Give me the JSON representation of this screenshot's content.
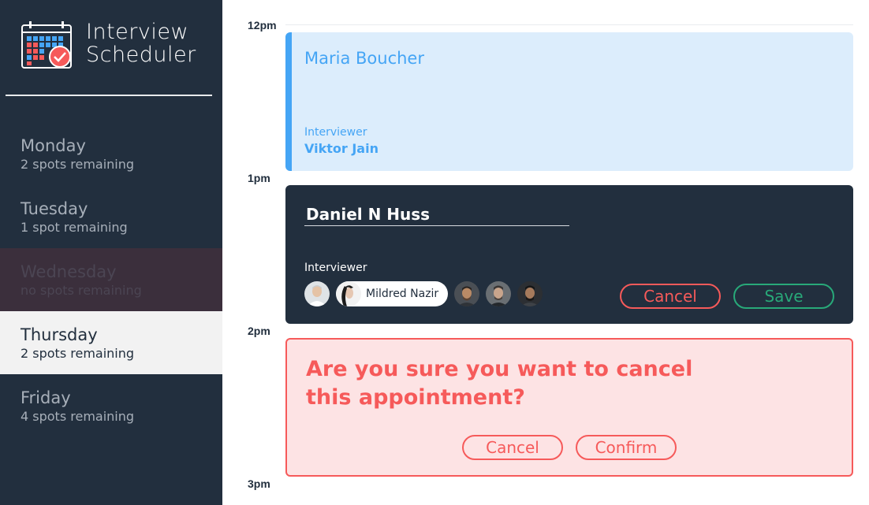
{
  "app": {
    "title_line1": "Interview",
    "title_line2": "Scheduler",
    "icon": "calendar-check-icon"
  },
  "days": [
    {
      "name": "Monday",
      "spots": "2 spots remaining",
      "state": "normal"
    },
    {
      "name": "Tuesday",
      "spots": "1 spot remaining",
      "state": "normal"
    },
    {
      "name": "Wednesday",
      "spots": "no spots remaining",
      "state": "full"
    },
    {
      "name": "Thursday",
      "spots": "2 spots remaining",
      "state": "selected"
    },
    {
      "name": "Friday",
      "spots": "4 spots remaining",
      "state": "normal"
    }
  ],
  "hours": [
    "12pm",
    "1pm",
    "2pm",
    "3pm"
  ],
  "booked": {
    "student": "Maria Boucher",
    "interviewer_label": "Interviewer",
    "interviewer": "Viktor Jain"
  },
  "form": {
    "student_value": "Daniel N Huss",
    "interviewer_label": "Interviewer",
    "selected_interviewer": "Mildred Nazir",
    "cancel_label": "Cancel",
    "save_label": "Save"
  },
  "confirm": {
    "message": "Are you sure you want to cancel this appointment?",
    "cancel_label": "Cancel",
    "confirm_label": "Confirm"
  },
  "colors": {
    "sidebar": "#222f3e",
    "booked_bg": "#dcedfc",
    "accent_blue": "#45a5f5",
    "danger": "#f65a5a",
    "success": "#28a979"
  }
}
